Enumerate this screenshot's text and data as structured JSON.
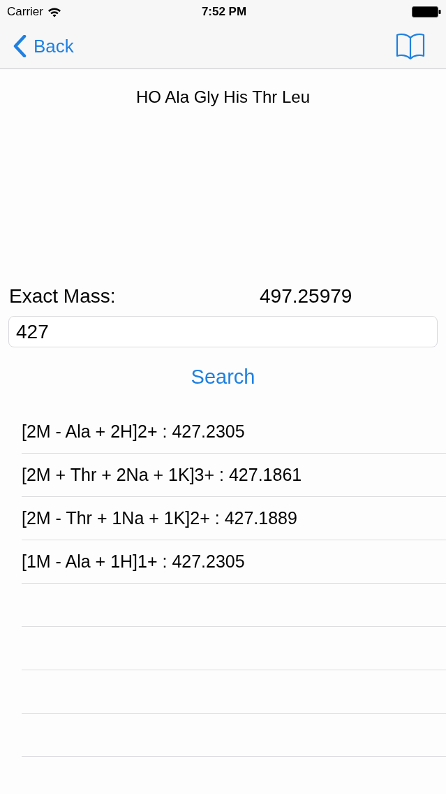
{
  "status_bar": {
    "carrier": "Carrier",
    "time": "7:52 PM"
  },
  "nav_bar": {
    "back_label": "Back"
  },
  "sequence": "HO Ala Gly His Thr Leu",
  "exact_mass": {
    "label": "Exact Mass:",
    "value": "497.25979"
  },
  "mass_field": {
    "value": "427"
  },
  "search_button": {
    "label": "Search"
  },
  "results": [
    "[2M - Ala + 2H]2+ : 427.2305",
    "[2M + Thr + 2Na + 1K]3+ : 427.1861",
    "[2M - Thr + 1Na + 1K]2+ : 427.1889",
    "[1M - Ala + 1H]1+ : 427.2305"
  ]
}
